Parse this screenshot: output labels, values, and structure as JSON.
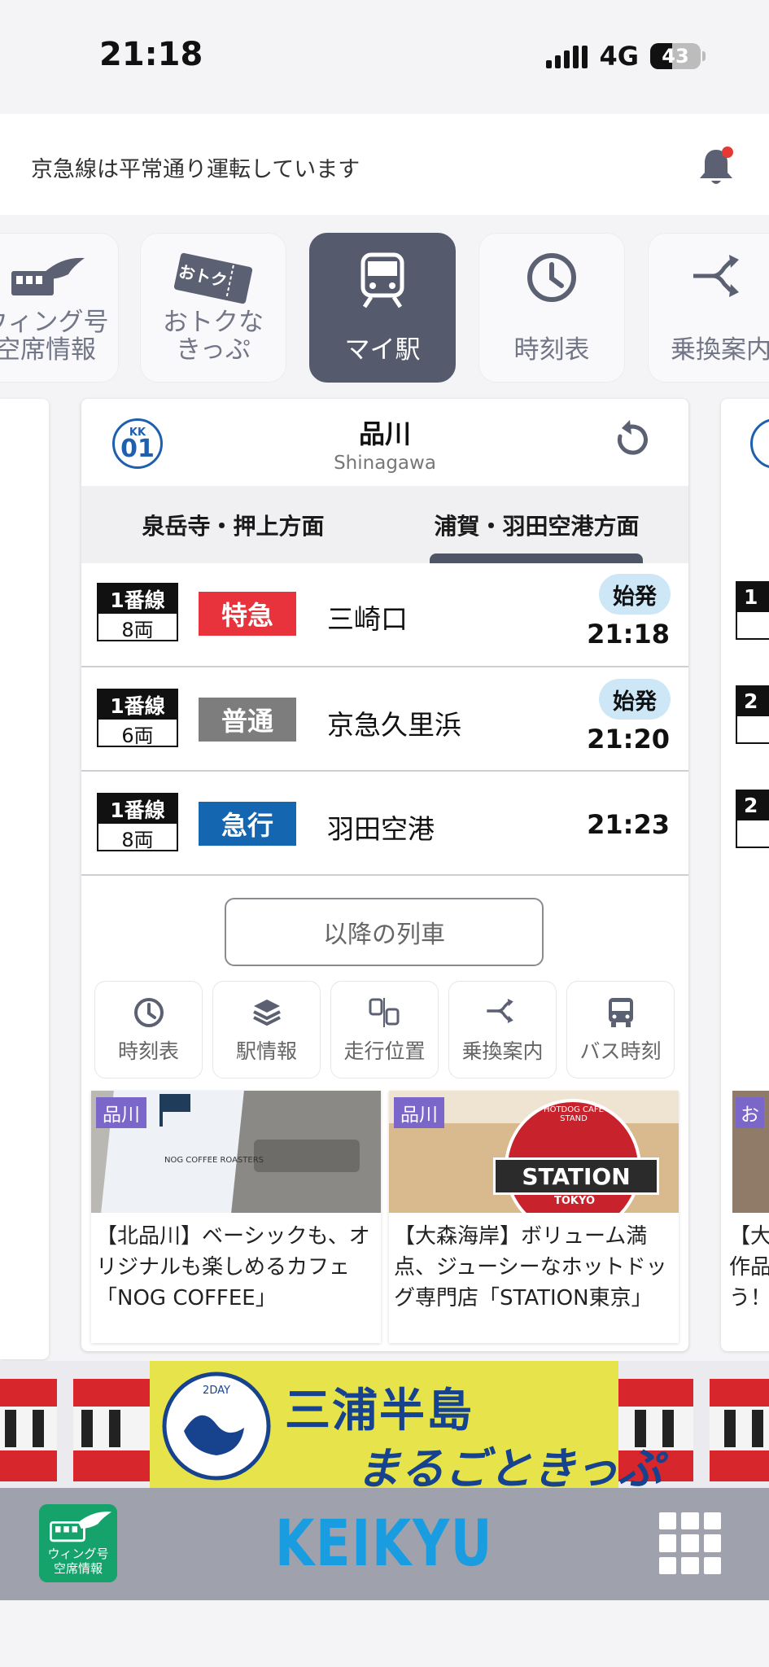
{
  "status_bar": {
    "time": "21:18",
    "network": "4G",
    "battery": "43"
  },
  "notice": {
    "text": "京急線は平常通り運転しています",
    "bell_icon": "bell-icon"
  },
  "nav": [
    {
      "label": "ウィング号\n空席情報",
      "icon": "wing-icon"
    },
    {
      "label": "おトクな\nきっぷ",
      "icon": "ticket-icon",
      "badge": "おトク"
    },
    {
      "label": "マイ駅",
      "icon": "train-icon",
      "active": true
    },
    {
      "label": "時刻表",
      "icon": "clock-icon"
    },
    {
      "label": "乗換案内",
      "icon": "transfer-icon"
    }
  ],
  "station": {
    "code_line": "KK",
    "code_num": "01",
    "name": "品川",
    "roman": "Shinagawa"
  },
  "direction_tabs": [
    {
      "label": "泉岳寺・押上方面",
      "active": false
    },
    {
      "label": "浦賀・羽田空港方面",
      "active": true
    }
  ],
  "departures": [
    {
      "track": "1番線",
      "cars": "8両",
      "type": "特急",
      "type_color": "#e8333c",
      "destination": "三崎口",
      "origin": "始発",
      "time": "21:18"
    },
    {
      "track": "1番線",
      "cars": "6両",
      "type": "普通",
      "type_color": "#7d7d7d",
      "destination": "京急久里浜",
      "origin": "始発",
      "time": "21:20"
    },
    {
      "track": "1番線",
      "cars": "8両",
      "type": "急行",
      "type_color": "#1466b0",
      "destination": "羽田空港",
      "origin": "",
      "time": "21:23"
    }
  ],
  "later_trains_label": "以降の列車",
  "sub_buttons": [
    {
      "label": "時刻表",
      "icon": "clock-icon"
    },
    {
      "label": "駅情報",
      "icon": "layers-icon"
    },
    {
      "label": "走行位置",
      "icon": "train-position-icon"
    },
    {
      "label": "乗換案内",
      "icon": "transfer-icon"
    },
    {
      "label": "バス時刻",
      "icon": "bus-icon"
    }
  ],
  "articles": [
    {
      "tag": "品川",
      "text": "【北品川】ベーシックも、オリジナルも楽しめるカフェ「NOG COFFEE」",
      "img_caption": "NOG COFFEE ROASTERS"
    },
    {
      "tag": "品川",
      "text": "【大森海岸】ボリューム満点、ジューシーなホットドッグ専門店「STATION東京」",
      "img_caption": "STATION",
      "img_sub": "TOKYO",
      "img_ring": "HOTDOG CAFE STAND"
    }
  ],
  "side_right": {
    "tag": "お",
    "track_partials": [
      "1",
      "2",
      "2"
    ],
    "text_partials": [
      "【大",
      "作品",
      "う！"
    ]
  },
  "banner": {
    "line1": "三浦半島",
    "line2": "まるごときっぷ",
    "seal_top": "2DAY",
    "seal_text": "三浦半島 まるごときっぷ"
  },
  "bottom_bar": {
    "wing_label": "ウィング号\n空席情報",
    "logo": "KEIKYU",
    "menu_icon": "grid-menu-icon"
  }
}
